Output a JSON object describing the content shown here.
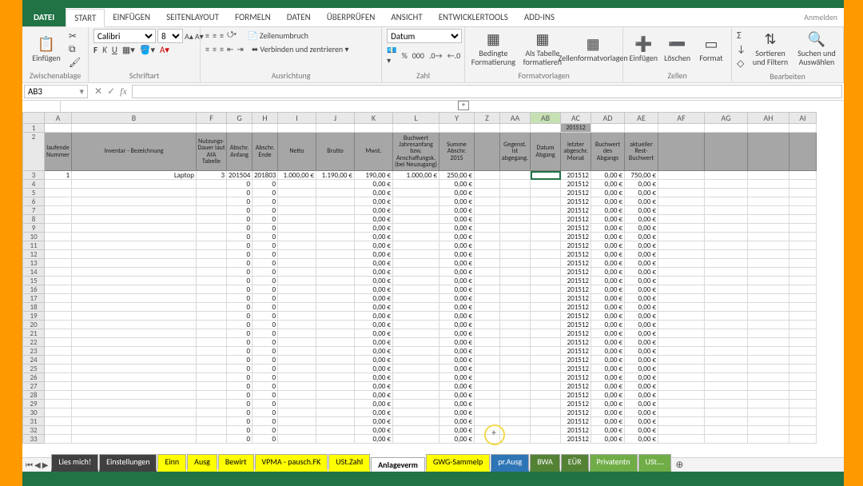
{
  "titlebar": {
    "anmelden": "Anmelden"
  },
  "tabs": {
    "file": "DATEI",
    "start": "START",
    "einfuegen": "EINFÜGEN",
    "seitenlayout": "SEITENLAYOUT",
    "formeln": "FORMELN",
    "daten": "DATEN",
    "ueberpruefen": "ÜBERPRÜFEN",
    "ansicht": "ANSICHT",
    "entwickler": "ENTWICKLERTOOLS",
    "addins": "ADD-INS"
  },
  "ribbon": {
    "clipboard": {
      "paste": "Einfügen",
      "group": "Zwischenablage"
    },
    "font": {
      "family": "Calibri",
      "size": "8",
      "group": "Schriftart"
    },
    "alignment": {
      "wrap": "Zeilenumbruch",
      "merge": "Verbinden und zentrieren",
      "group": "Ausrichtung"
    },
    "number": {
      "format": "Datum",
      "percent": "%",
      "thousand": "000",
      "group": "Zahl"
    },
    "styles": {
      "conditional": "Bedingte Formatierung",
      "table": "Als Tabelle formatieren",
      "cell": "Zellenformatvorlagen",
      "group": "Formatvorlagen"
    },
    "cells": {
      "insert": "Einfügen",
      "delete": "Löschen",
      "format": "Format",
      "group": "Zellen"
    },
    "editing": {
      "sum": "Σ",
      "fill": "↓",
      "clear": "◇",
      "sort": "Sortieren und Filtern",
      "find": "Suchen und Auswählen",
      "group": "Bearbeiten"
    }
  },
  "namebox": "AB3",
  "collapse": "+",
  "columns": [
    "A",
    "B",
    "F",
    "G",
    "H",
    "I",
    "J",
    "K",
    "L",
    "Y",
    "Z",
    "AA",
    "AB",
    "AC",
    "AD",
    "AE",
    "AF",
    "AG",
    "AH",
    "AI"
  ],
  "active_column": "AB",
  "badge_AC": "201512",
  "headers": {
    "A": "laufende Nummer",
    "B": "Inventar - Bezeichnung",
    "F": "Nutzungs-Dauer laut AfA Tabelle",
    "G": "Abschr. Anfang",
    "H": "Abschr. Ende",
    "I": "Netto",
    "J": "Brutto",
    "K": "Mwst.",
    "L": "Buchwert Jahresanfang bzw. Anschaffungsk. (bei Neuzugang)",
    "Y": "Summe Abschr. 2015",
    "Z": "",
    "AA": "Gegenst. ist abgegang.",
    "AB": "Datum Abgang",
    "AC": "letzter abgeschr. Monat",
    "AD": "Buchwert des Abgangs",
    "AE": "aktueller Rest-Buchwert",
    "AF": "",
    "AG": "",
    "AH": "",
    "AI": ""
  },
  "first_row": {
    "A": "1",
    "B": "Laptop",
    "F": "3",
    "G": "201504",
    "H": "201803",
    "I": "1.000,00 €",
    "J": "1.190,00 €",
    "K": "190,00 €",
    "L": "1.000,00 €",
    "Y": "250,00 €",
    "AC": "201512",
    "AD": "0,00 €",
    "AE": "750,00 €"
  },
  "repeat_row": {
    "G": "0",
    "H": "0",
    "K": "0,00 €",
    "Y": "0,00 €",
    "AC": "201512",
    "AD": "0,00 €",
    "AE": "0,00 €"
  },
  "row_count": 33,
  "sheets": [
    {
      "name": "Lies mich!",
      "color": "#404040",
      "text": "#fff"
    },
    {
      "name": "Einstellungen",
      "color": "#404040",
      "text": "#fff"
    },
    {
      "name": "Einn",
      "color": "#ffff00",
      "text": "#000"
    },
    {
      "name": "Ausg",
      "color": "#ffff00",
      "text": "#000"
    },
    {
      "name": "Bewirt",
      "color": "#ffff00",
      "text": "#000"
    },
    {
      "name": "VPMA - pausch.FK",
      "color": "#ffff00",
      "text": "#000"
    },
    {
      "name": "USt.Zahl",
      "color": "#ffff00",
      "text": "#000"
    },
    {
      "name": "Anlageverm",
      "color": "#ffff00",
      "text": "#000",
      "active": true
    },
    {
      "name": "GWG-Sammelp",
      "color": "#ffff00",
      "text": "#000"
    },
    {
      "name": "pr.Ausg",
      "color": "#2e75b6",
      "text": "#fff"
    },
    {
      "name": "BWA",
      "color": "#548235",
      "text": "#fff"
    },
    {
      "name": "EÜR",
      "color": "#548235",
      "text": "#fff"
    },
    {
      "name": "Privatentn",
      "color": "#70ad47",
      "text": "#fff"
    },
    {
      "name": "USt.…",
      "color": "#70ad47",
      "text": "#fff"
    }
  ]
}
